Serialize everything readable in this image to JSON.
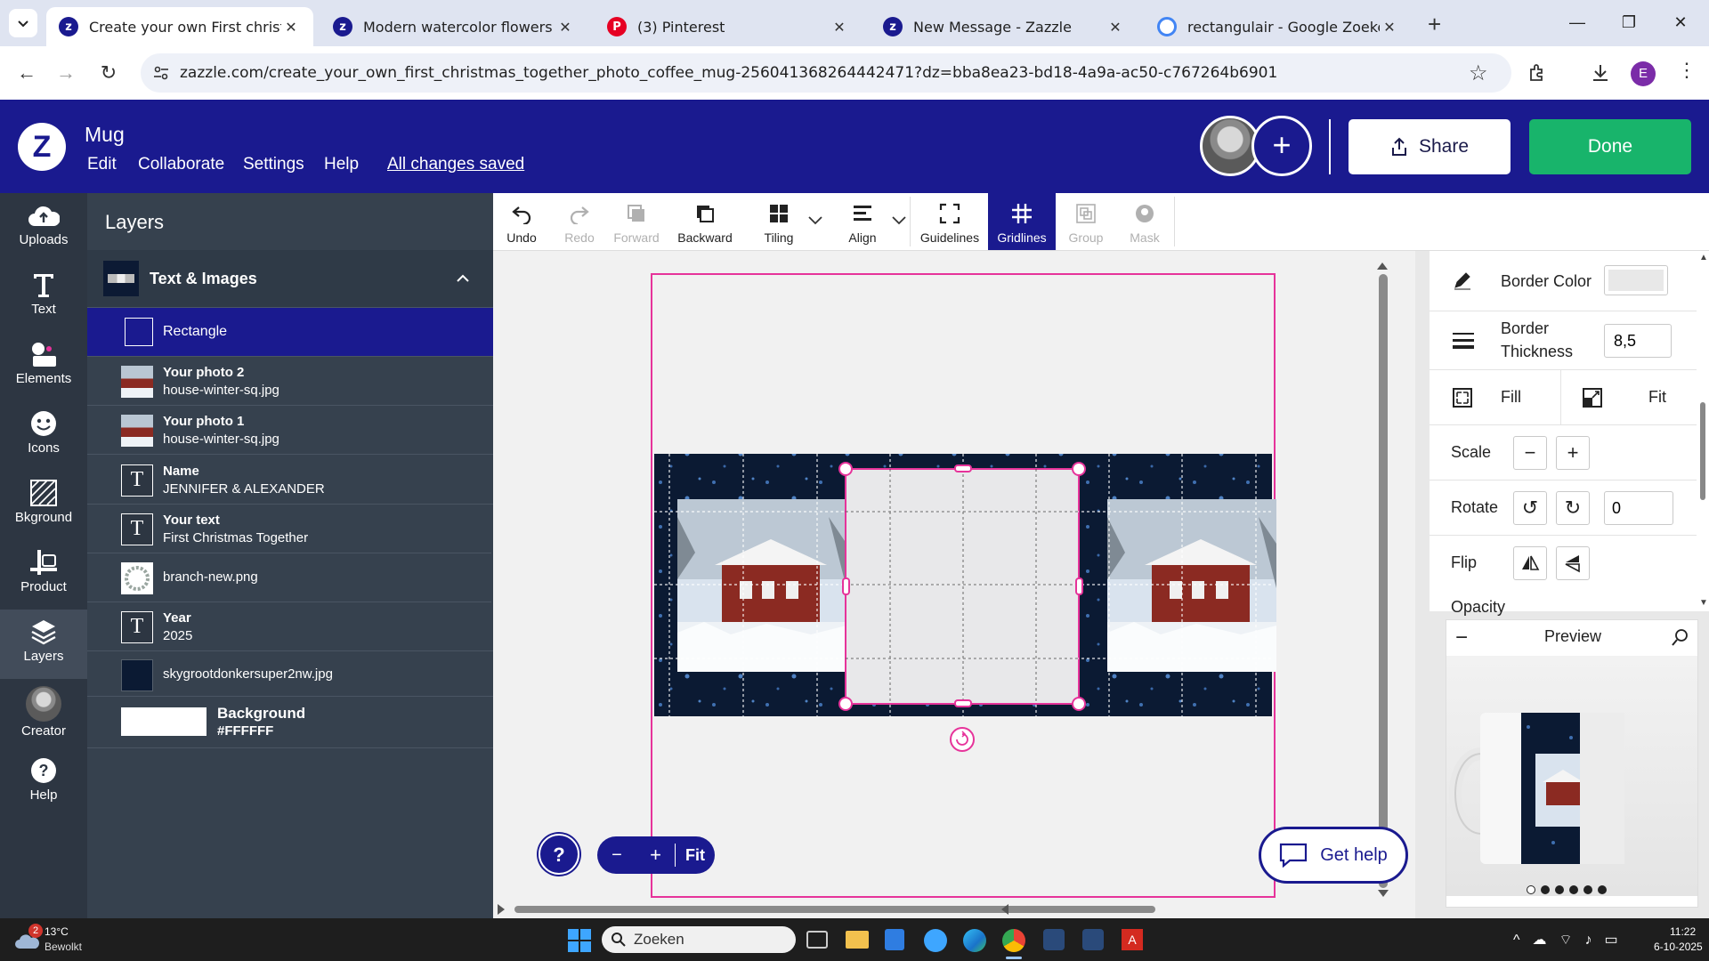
{
  "browser": {
    "tabs": [
      {
        "title": "Create your own First christmas",
        "icon": "zazzle-icon",
        "active": true
      },
      {
        "title": "Modern watercolor flowers blac",
        "icon": "zazzle-icon",
        "active": false
      },
      {
        "title": "(3) Pinterest",
        "icon": "pinterest-icon",
        "active": false
      },
      {
        "title": "New Message - Zazzle",
        "icon": "zazzle-icon",
        "active": false
      },
      {
        "title": "rectangulair - Google Zoeken",
        "icon": "google-icon",
        "active": false
      }
    ],
    "new_tab": "+",
    "url": "zazzle.com/create_your_own_first_christmas_together_photo_coffee_mug-256041368264442471?dz=bba8ea23-bd18-4a9a-ac50-c767264b6901",
    "profile_initial": "E"
  },
  "header": {
    "logo": "Z",
    "product": "Mug",
    "menu": [
      "Edit",
      "Collaborate",
      "Settings",
      "Help"
    ],
    "save_status": "All changes saved",
    "share_label": "Share",
    "done_label": "Done",
    "add_label": "+"
  },
  "rail": [
    {
      "label": "Uploads",
      "icon": "cloud-upload-icon"
    },
    {
      "label": "Text",
      "icon": "text-icon"
    },
    {
      "label": "Elements",
      "icon": "elements-icon"
    },
    {
      "label": "Icons",
      "icon": "smiley-icon"
    },
    {
      "label": "Bkground",
      "icon": "background-icon"
    },
    {
      "label": "Product",
      "icon": "product-icon"
    },
    {
      "label": "Layers",
      "icon": "layers-icon",
      "selected": true
    },
    {
      "label": "Creator",
      "icon": "creator-avatar"
    },
    {
      "label": "Help",
      "icon": "help-icon"
    }
  ],
  "layers": {
    "title": "Layers",
    "group": "Text & Images",
    "items": [
      {
        "name": "Rectangle",
        "kind": "rect",
        "selected": true
      },
      {
        "name": "Your photo 2",
        "sub": "house-winter-sq.jpg",
        "kind": "photo"
      },
      {
        "name": "Your photo 1",
        "sub": "house-winter-sq.jpg",
        "kind": "photo"
      },
      {
        "name": "Name",
        "sub": "JENNIFER & ALEXANDER",
        "kind": "text"
      },
      {
        "name": "Your text",
        "sub": "First Christmas Together",
        "kind": "text"
      },
      {
        "name": "branch-new.png",
        "kind": "wreath"
      },
      {
        "name": "Year",
        "sub": "2025",
        "kind": "text"
      },
      {
        "name": "skygrootdonkersuper2nw.jpg",
        "kind": "dark"
      }
    ],
    "background": {
      "name": "Background",
      "value": "#FFFFFF"
    }
  },
  "toolbar": [
    {
      "label": "Undo",
      "icon": "undo-icon",
      "state": "enabled"
    },
    {
      "label": "Redo",
      "icon": "redo-icon",
      "state": "disabled"
    },
    {
      "label": "Forward",
      "icon": "forward-icon",
      "state": "disabled"
    },
    {
      "label": "Backward",
      "icon": "backward-icon",
      "state": "enabled"
    },
    {
      "label": "Tiling",
      "icon": "tiling-icon",
      "state": "enabled",
      "dropdown": true
    },
    {
      "label": "Align",
      "icon": "align-icon",
      "state": "enabled",
      "dropdown": true
    },
    {
      "label": "Guidelines",
      "icon": "guidelines-icon",
      "state": "enabled"
    },
    {
      "label": "Gridlines",
      "icon": "gridlines-icon",
      "state": "selected"
    },
    {
      "label": "Group",
      "icon": "group-icon",
      "state": "disabled"
    },
    {
      "label": "Mask",
      "icon": "mask-icon",
      "state": "disabled"
    }
  ],
  "properties": {
    "border_color_label": "Border Color",
    "border_color_value": "#e8e8e8",
    "border_thickness_label": "Border\nThickness",
    "border_thickness_value": "8,5",
    "fill_label": "Fill",
    "fit_label": "Fit",
    "scale_label": "Scale",
    "rotate_label": "Rotate",
    "rotate_value": "0",
    "flip_label": "Flip",
    "opacity_label": "Opacity"
  },
  "preview": {
    "title": "Preview",
    "dots": 6,
    "active_dot": 0
  },
  "zoom": {
    "minus": "−",
    "plus": "+",
    "fit": "Fit",
    "help": "?"
  },
  "get_help": "Get help",
  "taskbar": {
    "weather_temp": "13°C",
    "weather_desc": "Bewolkt",
    "weather_badge": "2",
    "search_placeholder": "Zoeken",
    "time": "11:22",
    "date": "6-10-2025"
  },
  "colors": {
    "brand": "#1a1a8f",
    "done": "#18b46b",
    "selection": "#e6339a"
  }
}
